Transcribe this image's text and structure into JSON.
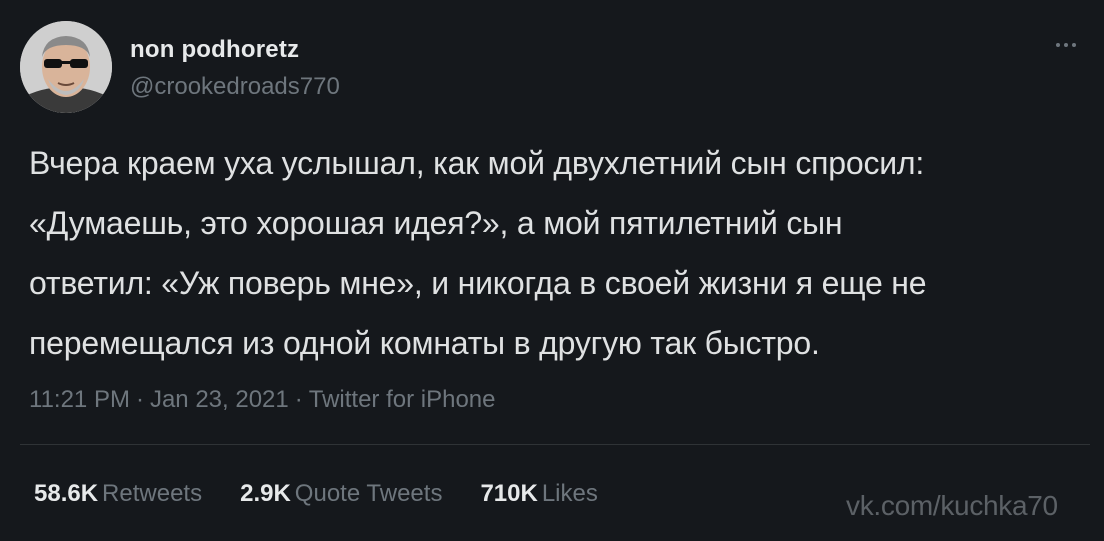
{
  "author": {
    "display_name": "non podhoretz",
    "handle": "@crookedroads770"
  },
  "tweet": {
    "lines": [
      "Вчера краем уха услышал, как мой двухлетний сын спросил:",
      "«Думаешь, это хорошая идея?», а мой пятилетний сын",
      "ответил: «Уж поверь мне», и никогда в своей жизни я еще не",
      "перемещался из одной комнаты в другую так быстро."
    ]
  },
  "meta": {
    "time": "11:21 PM",
    "separator": "·",
    "date": "Jan 23, 2021",
    "source": "Twitter for iPhone"
  },
  "stats": {
    "retweets": {
      "count": "58.6K",
      "label": "Retweets"
    },
    "quote_tweets": {
      "count": "2.9K",
      "label": "Quote Tweets"
    },
    "likes": {
      "count": "710K",
      "label": "Likes"
    }
  },
  "watermark": "vk.com/kuchka70",
  "icons": {
    "more": "more-horizontal-icon"
  },
  "colors": {
    "background": "#15181c",
    "text_primary": "#e7e9ea",
    "text_secondary": "#6e767d",
    "divider": "#2f3336"
  }
}
